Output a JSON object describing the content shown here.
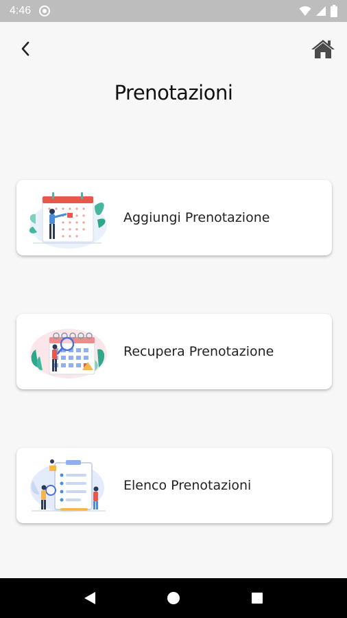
{
  "status_bar": {
    "time": "4:46",
    "icons": [
      "sync-icon",
      "wifi-icon",
      "signal-icon",
      "battery-icon"
    ]
  },
  "header": {
    "back_icon": "chevron-left-icon",
    "home_icon": "home-icon",
    "title": "Prenotazioni"
  },
  "menu": {
    "items": [
      {
        "label": "Aggiungi Prenotazione",
        "illustration": "calendar-person-illustration"
      },
      {
        "label": "Recupera Prenotazione",
        "illustration": "calendar-search-illustration"
      },
      {
        "label": "Elenco Prenotazioni",
        "illustration": "list-document-illustration"
      }
    ]
  },
  "nav_bar": {
    "icons": [
      "back-triangle-icon",
      "home-circle-icon",
      "recents-square-icon"
    ]
  },
  "colors": {
    "accent_red": "#e8584a",
    "accent_blue": "#4a6fd6",
    "leaf_green": "#2fb59a",
    "background": "#f7f7f7",
    "status_bar": "#bdbdbd"
  }
}
